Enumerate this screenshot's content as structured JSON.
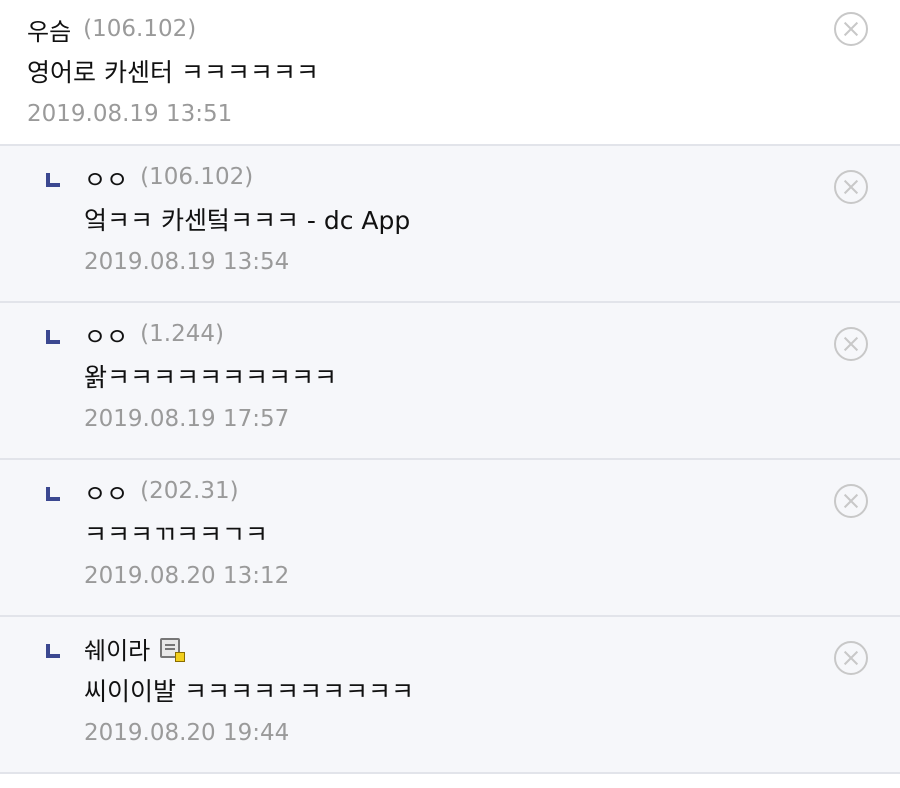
{
  "comments": [
    {
      "nick": "우슴",
      "ip": "(106.102)",
      "text": "영어로 카센터 ㅋㅋㅋㅋㅋㅋ",
      "date": "2019.08.19 13:51",
      "reply": false
    },
    {
      "nick": "ㅇㅇ",
      "ip": "(106.102)",
      "text": "엌ㅋㅋ 카센텈ㅋㅋㅋ - dc App",
      "date": "2019.08.19 13:54",
      "reply": true
    },
    {
      "nick": "ㅇㅇ",
      "ip": "(1.244)",
      "text": "왉ㅋㅋㅋㅋㅋㅋㅋㅋㅋㅋ",
      "date": "2019.08.19 17:57",
      "reply": true
    },
    {
      "nick": "ㅇㅇ",
      "ip": "(202.31)",
      "text": "ㅋㅋㅋㄲㅋㅋㄱㅋ",
      "date": "2019.08.20 13:12",
      "reply": true
    },
    {
      "nick": "쉐이라",
      "ip": "",
      "text": "씨이이발 ㅋㅋㅋㅋㅋㅋㅋㅋㅋㅋ",
      "date": "2019.08.20 19:44",
      "reply": true,
      "icon": "gallog-icon"
    }
  ],
  "icons": {
    "delete": "close-circle-icon",
    "reply": "reply-arrow-icon"
  },
  "colors": {
    "reply_mark": "#3b4890",
    "reply_bg": "#f6f7fa",
    "meta": "#9a9a9a",
    "divider": "#e2e4ea"
  }
}
